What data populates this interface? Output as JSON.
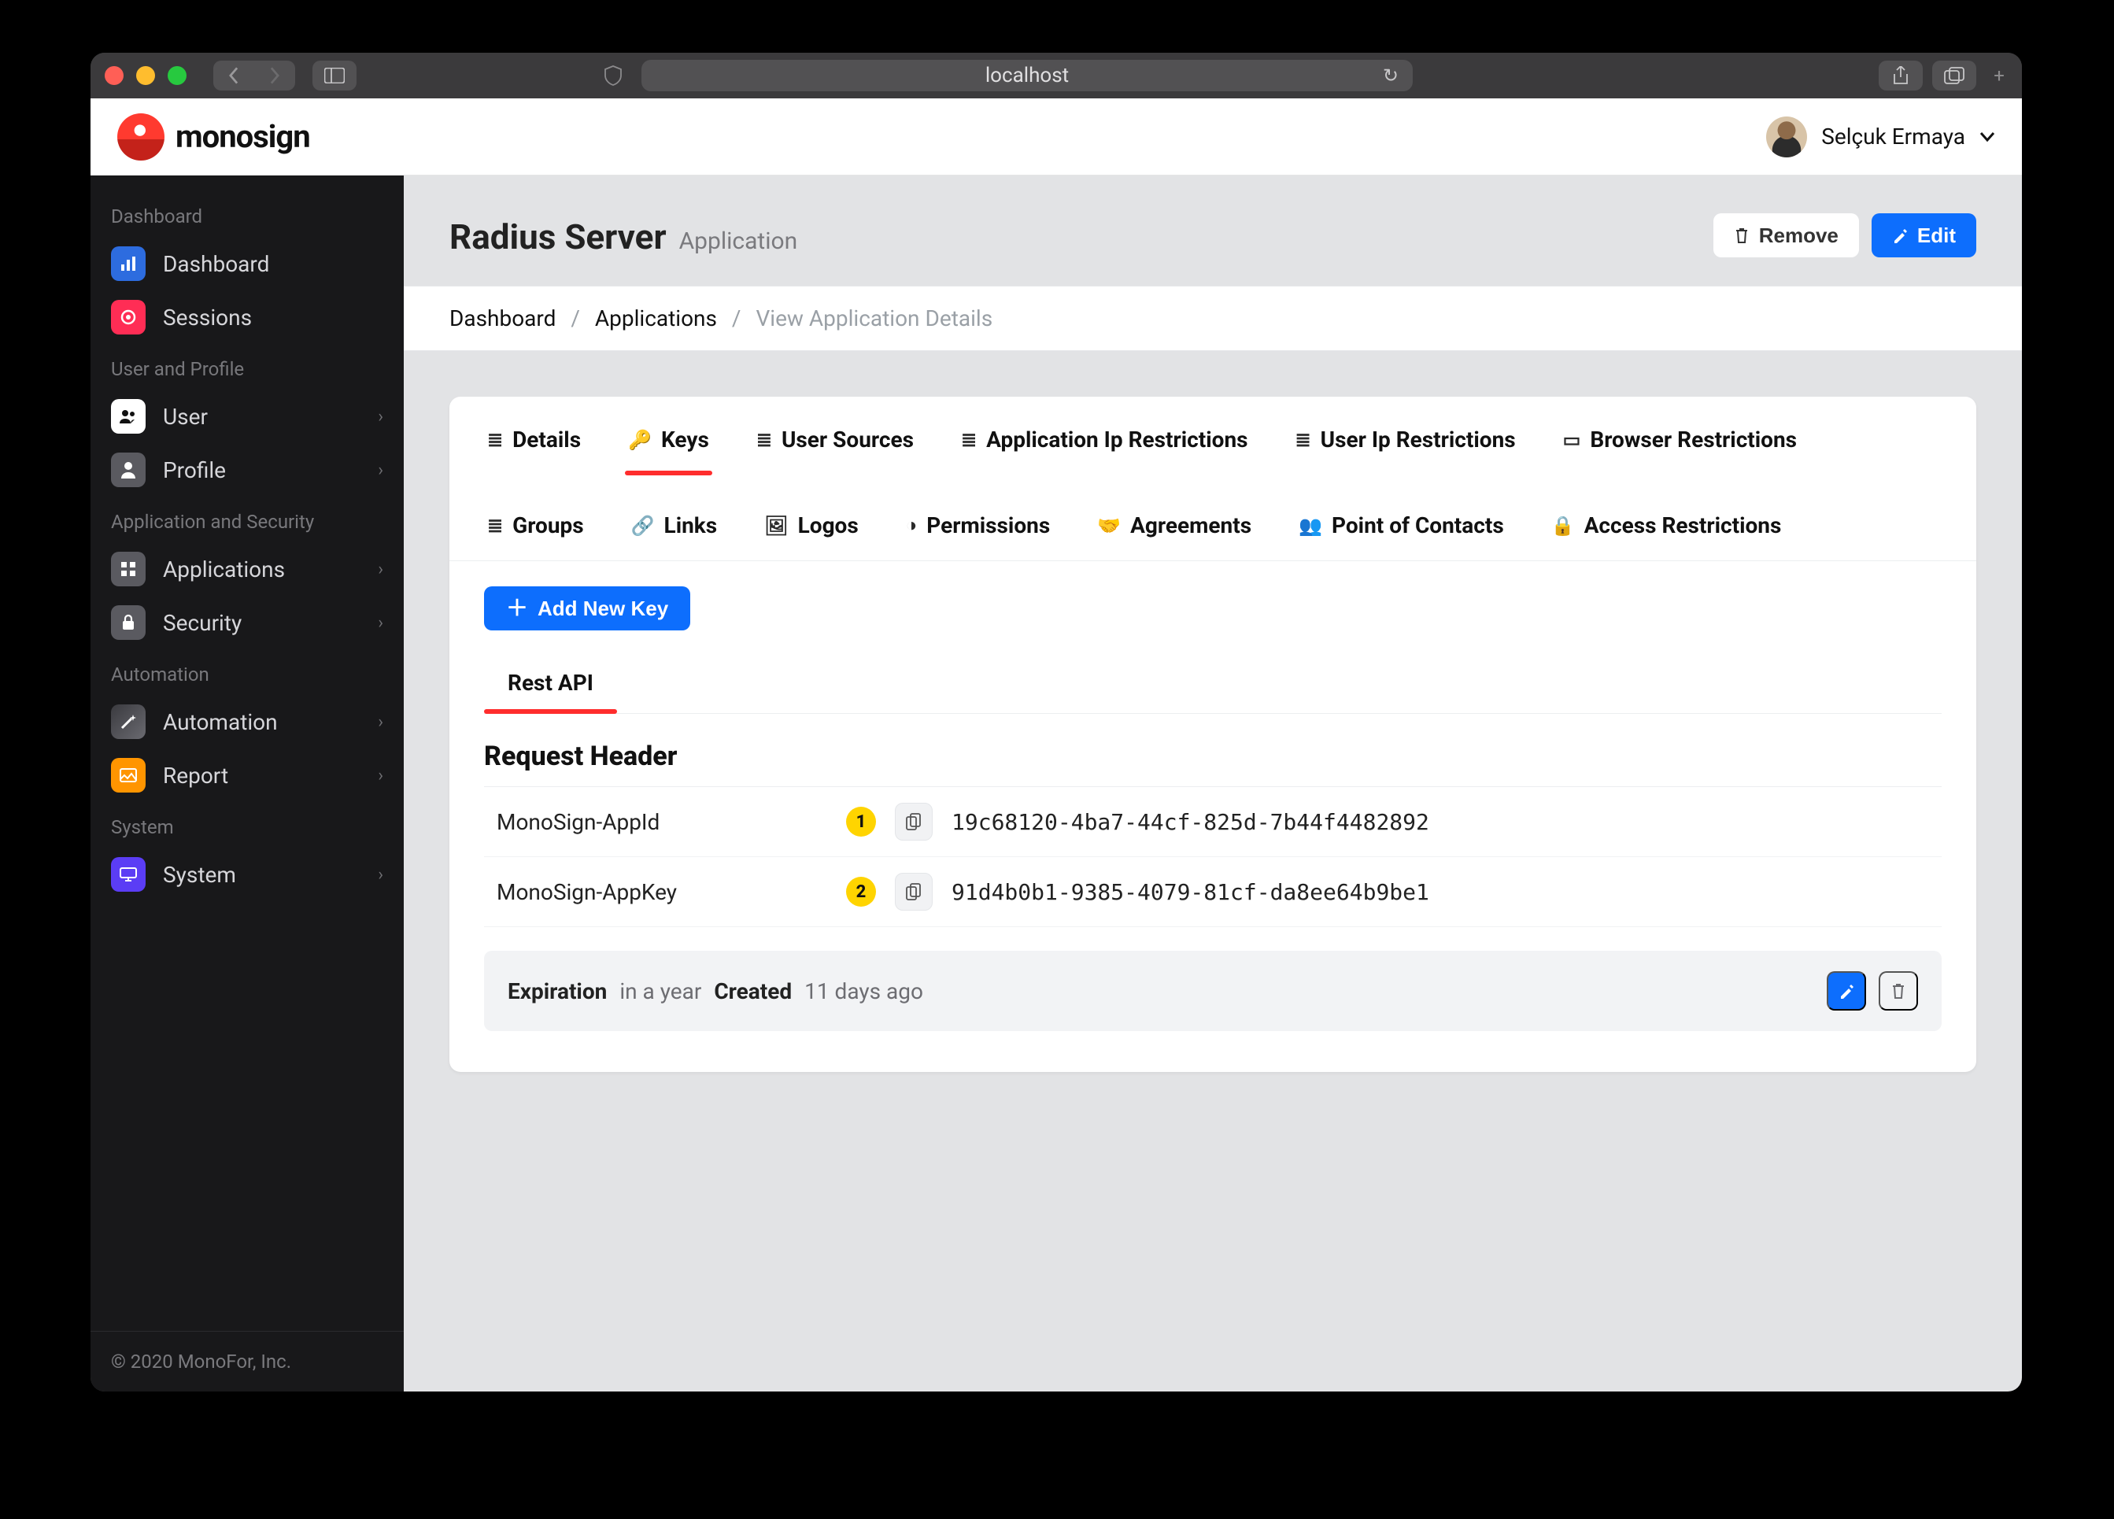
{
  "browser": {
    "address": "localhost"
  },
  "app": {
    "brand": "monosign",
    "user_name": "Selçuk Ermaya"
  },
  "sidebar": {
    "sections": [
      {
        "title": "Dashboard",
        "items": [
          {
            "label": "Dashboard",
            "icon": "chart",
            "has_chev": false
          },
          {
            "label": "Sessions",
            "icon": "target",
            "has_chev": false
          }
        ]
      },
      {
        "title": "User and Profile",
        "items": [
          {
            "label": "User",
            "icon": "users-white",
            "has_chev": true
          },
          {
            "label": "Profile",
            "icon": "person-grey",
            "has_chev": true
          }
        ]
      },
      {
        "title": "Application and Security",
        "items": [
          {
            "label": "Applications",
            "icon": "grid-grey",
            "has_chev": true
          },
          {
            "label": "Security",
            "icon": "lock-grey",
            "has_chev": true
          }
        ]
      },
      {
        "title": "Automation",
        "items": [
          {
            "label": "Automation",
            "icon": "wand-grad",
            "has_chev": true
          },
          {
            "label": "Report",
            "icon": "image-orange",
            "has_chev": true
          }
        ]
      },
      {
        "title": "System",
        "items": [
          {
            "label": "System",
            "icon": "monitor-purple",
            "has_chev": true
          }
        ]
      }
    ],
    "footer": "© 2020 MonoFor, Inc."
  },
  "page": {
    "title": "Radius Server",
    "subtitle": "Application",
    "actions": {
      "remove": "Remove",
      "edit": "Edit"
    },
    "crumbs": [
      "Dashboard",
      "Applications",
      "View Application Details"
    ],
    "tabs_row1": [
      "Details",
      "Keys",
      "User Sources",
      "Application Ip Restrictions",
      "User Ip Restrictions",
      "Browser Restrictions"
    ],
    "tabs_row2": [
      "Groups",
      "Links",
      "Logos",
      "Permissions",
      "Agreements",
      "Point of Contacts",
      "Access Restrictions"
    ],
    "active_tab": "Keys",
    "add_button": "Add New Key",
    "subtabs": [
      "Rest API"
    ],
    "active_subtab": "Rest API",
    "section_title": "Request Header",
    "rows": [
      {
        "label": "MonoSign-AppId",
        "num": "1",
        "value": "19c68120-4ba7-44cf-825d-7b44f4482892"
      },
      {
        "label": "MonoSign-AppKey",
        "num": "2",
        "value": "91d4b0b1-9385-4079-81cf-da8ee64b9be1"
      }
    ],
    "meta": {
      "expiration_label": "Expiration",
      "expiration_value": "in a year",
      "created_label": "Created",
      "created_value": "11 days ago"
    }
  }
}
